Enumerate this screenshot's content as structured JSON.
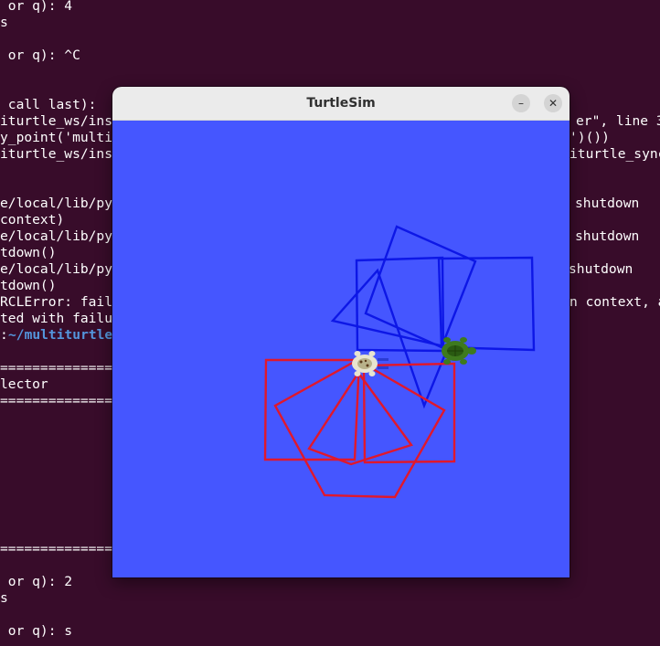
{
  "terminal": {
    "lines": [
      {
        "text": " or q): 4",
        "style": "normal"
      },
      {
        "text": "s",
        "style": "normal"
      },
      {
        "text": " or q): ^C",
        "style": "normal"
      },
      {
        "text": " call last):",
        "style": "normal"
      },
      {
        "text": "iturtle_ws/ins",
        "right": "er\", line 3",
        "style": "normal"
      },
      {
        "text": "y_point('multi",
        "right": "')())",
        "style": "normal"
      },
      {
        "text": "iturtle_ws/ins",
        "right": "iturtle_sync",
        "style": "normal"
      },
      {
        "text": "e/local/lib/py",
        "right": "shutdown",
        "style": "normal"
      },
      {
        "text": "context)",
        "style": "normal"
      },
      {
        "text": "e/local/lib/py",
        "right": "shutdown",
        "style": "normal"
      },
      {
        "text": "tdown()",
        "style": "normal"
      },
      {
        "text": "e/local/lib/py",
        "right": "shutdown",
        "style": "normal"
      },
      {
        "text": "tdown()",
        "style": "normal"
      },
      {
        "text": "RCLError: fail",
        "right": "n context, a",
        "style": "normal"
      },
      {
        "text": "ted with failu",
        "style": "normal"
      },
      {
        "text": ":",
        "path": "~/multiturtle",
        "style": "prompt"
      },
      {
        "text": "================",
        "style": "normal"
      },
      {
        "text": "lector",
        "style": "normal"
      },
      {
        "text": "================",
        "style": "normal"
      },
      {
        "text": "================",
        "style": "normal"
      },
      {
        "text": " or q): 2",
        "style": "normal"
      },
      {
        "text": "s",
        "style": "normal"
      },
      {
        "text": " or q): s",
        "style": "normal"
      }
    ]
  },
  "window": {
    "title": "TurtleSim",
    "minimize_symbol": "–",
    "close_symbol": "✕",
    "colors": {
      "background": "#4556ff",
      "pen_blue": "#0d17e6",
      "pen_red": "#e0182c",
      "turtle_green": "#3e7a1e",
      "turtle_white": "#e8e4cf"
    }
  }
}
